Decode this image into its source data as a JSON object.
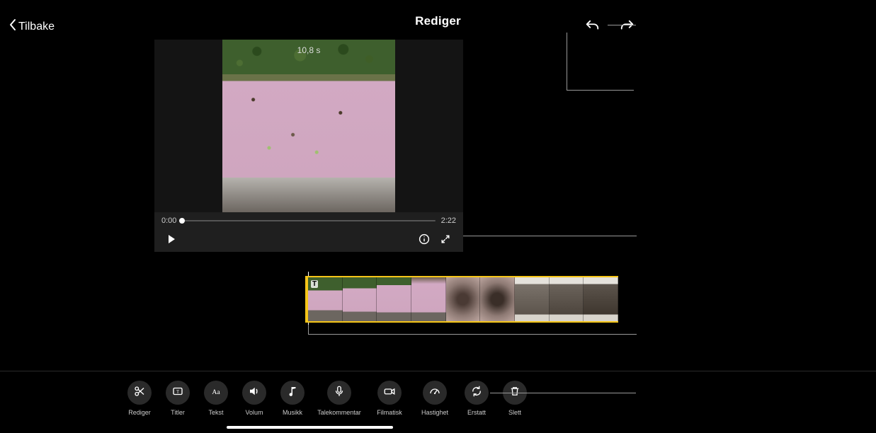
{
  "header": {
    "back_label": "Tilbake",
    "title": "Rediger"
  },
  "preview": {
    "clip_duration_label": "10,8 s",
    "current_time": "0:00",
    "total_time": "2:22"
  },
  "timeline": {
    "text_overlay_badge": "T"
  },
  "toolbar": {
    "items": [
      {
        "id": "rediger",
        "label": "Rediger",
        "icon": "scissors-icon"
      },
      {
        "id": "titler",
        "label": "Titler",
        "icon": "title-frame-icon"
      },
      {
        "id": "tekst",
        "label": "Tekst",
        "icon": "text-aa-icon"
      },
      {
        "id": "volum",
        "label": "Volum",
        "icon": "speaker-icon"
      },
      {
        "id": "musikk",
        "label": "Musikk",
        "icon": "music-note-icon"
      },
      {
        "id": "talekommentar",
        "label": "Talekommentar",
        "icon": "microphone-icon"
      },
      {
        "id": "filmatisk",
        "label": "Filmatisk",
        "icon": "camera-icon"
      },
      {
        "id": "hastighet",
        "label": "Hastighet",
        "icon": "speedometer-icon"
      },
      {
        "id": "erstatt",
        "label": "Erstatt",
        "icon": "replace-icon"
      },
      {
        "id": "slett",
        "label": "Slett",
        "icon": "trash-icon"
      }
    ]
  }
}
